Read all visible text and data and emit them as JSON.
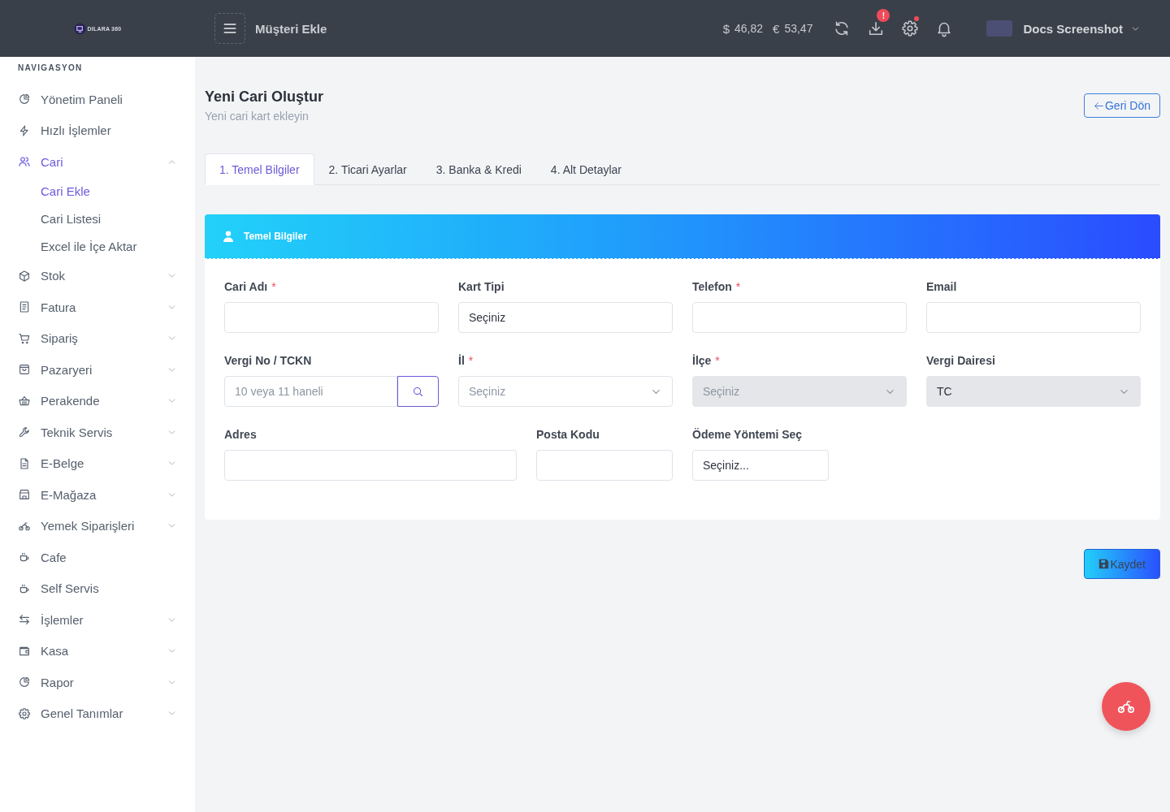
{
  "topbar": {
    "logo_text": "DILARA 360",
    "page_title": "Müşteri Ekle",
    "currencies": [
      {
        "symbol": "$",
        "value": "46,82"
      },
      {
        "symbol": "€",
        "value": "53,47"
      }
    ],
    "download_badge": "!",
    "settings_alert": true,
    "user_name": "Docs Screenshot"
  },
  "sidebar": {
    "section_title": "NAVIGASYON",
    "items": [
      {
        "kind": "link",
        "label": "Yönetim Paneli",
        "selected": false
      },
      {
        "kind": "link",
        "label": "Hızlı İşlemler",
        "selected": false
      },
      {
        "kind": "group",
        "label": "Cari",
        "selected": true,
        "expanded": true,
        "children": [
          {
            "label": "Cari Ekle",
            "selected": true
          },
          {
            "label": "Cari Listesi",
            "selected": false
          },
          {
            "label": "Excel ile İçe Aktar",
            "selected": false
          }
        ]
      },
      {
        "kind": "group",
        "label": "Stok",
        "selected": false,
        "expanded": false
      },
      {
        "kind": "group",
        "label": "Fatura",
        "selected": false,
        "expanded": false
      },
      {
        "kind": "group",
        "label": "Sipariş",
        "selected": false,
        "expanded": false
      },
      {
        "kind": "group",
        "label": "Pazaryeri",
        "selected": false,
        "expanded": false
      },
      {
        "kind": "group",
        "label": "Perakende",
        "selected": false,
        "expanded": false
      },
      {
        "kind": "group",
        "label": "Teknik Servis",
        "selected": false,
        "expanded": false
      },
      {
        "kind": "group",
        "label": "E-Belge",
        "selected": false,
        "expanded": false
      },
      {
        "kind": "group",
        "label": "E-Mağaza",
        "selected": false,
        "expanded": false
      },
      {
        "kind": "group",
        "label": "Yemek Siparişleri",
        "selected": false,
        "expanded": false
      },
      {
        "kind": "link",
        "label": "Cafe",
        "selected": false
      },
      {
        "kind": "link",
        "label": "Self Servis",
        "selected": false
      },
      {
        "kind": "group",
        "label": "İşlemler",
        "selected": false,
        "expanded": false
      },
      {
        "kind": "group",
        "label": "Kasa",
        "selected": false,
        "expanded": false
      },
      {
        "kind": "group",
        "label": "Rapor",
        "selected": false,
        "expanded": false
      },
      {
        "kind": "group",
        "label": "Genel Tanımlar",
        "selected": false,
        "expanded": false
      }
    ]
  },
  "page_header": {
    "title": "Yeni Cari Oluştur",
    "subtitle": "Yeni cari kart ekleyin",
    "back_button": "Geri Dön"
  },
  "tabs": [
    {
      "label": "1. Temel Bilgiler",
      "selected": true
    },
    {
      "label": "2. Ticari Ayarlar",
      "selected": false
    },
    {
      "label": "3. Banka & Kredi",
      "selected": false
    },
    {
      "label": "4. Alt Detaylar",
      "selected": false
    }
  ],
  "form_card": {
    "title": "Temel Bilgiler",
    "rows": [
      [
        {
          "kind": "text",
          "label": "Cari Adı",
          "required_mark": "*",
          "disabled": false
        },
        {
          "kind": "select",
          "label": "Kart Tipi",
          "value": "Seçiniz",
          "disabled": false
        },
        {
          "kind": "text",
          "label": "Telefon",
          "required_mark": "*",
          "disabled": false
        },
        {
          "kind": "text",
          "label": "Email",
          "disabled": false
        }
      ],
      [
        {
          "kind": "search",
          "label": "Vergi No / TCKN",
          "placeholder": "10 veya 11 haneli",
          "disabled": false
        },
        {
          "kind": "dropdown",
          "label": "İl",
          "required_mark": "*",
          "placeholder": "Seçiniz",
          "disabled": false
        },
        {
          "kind": "dropdown",
          "label": "İlçe",
          "required_mark": "*",
          "placeholder": "Seçiniz",
          "disabled": true
        },
        {
          "kind": "dropdown",
          "label": "Vergi Dairesi",
          "value": "TC",
          "disabled": true
        }
      ],
      [
        {
          "kind": "text",
          "label": "Adres",
          "disabled": false
        },
        {
          "kind": "text",
          "label": "Posta Kodu",
          "disabled": false
        },
        {
          "kind": "select",
          "label": "Ödeme Yöntemi Seç",
          "value": "Seçiniz...",
          "disabled": false
        }
      ]
    ]
  },
  "save_button": "Kaydet"
}
